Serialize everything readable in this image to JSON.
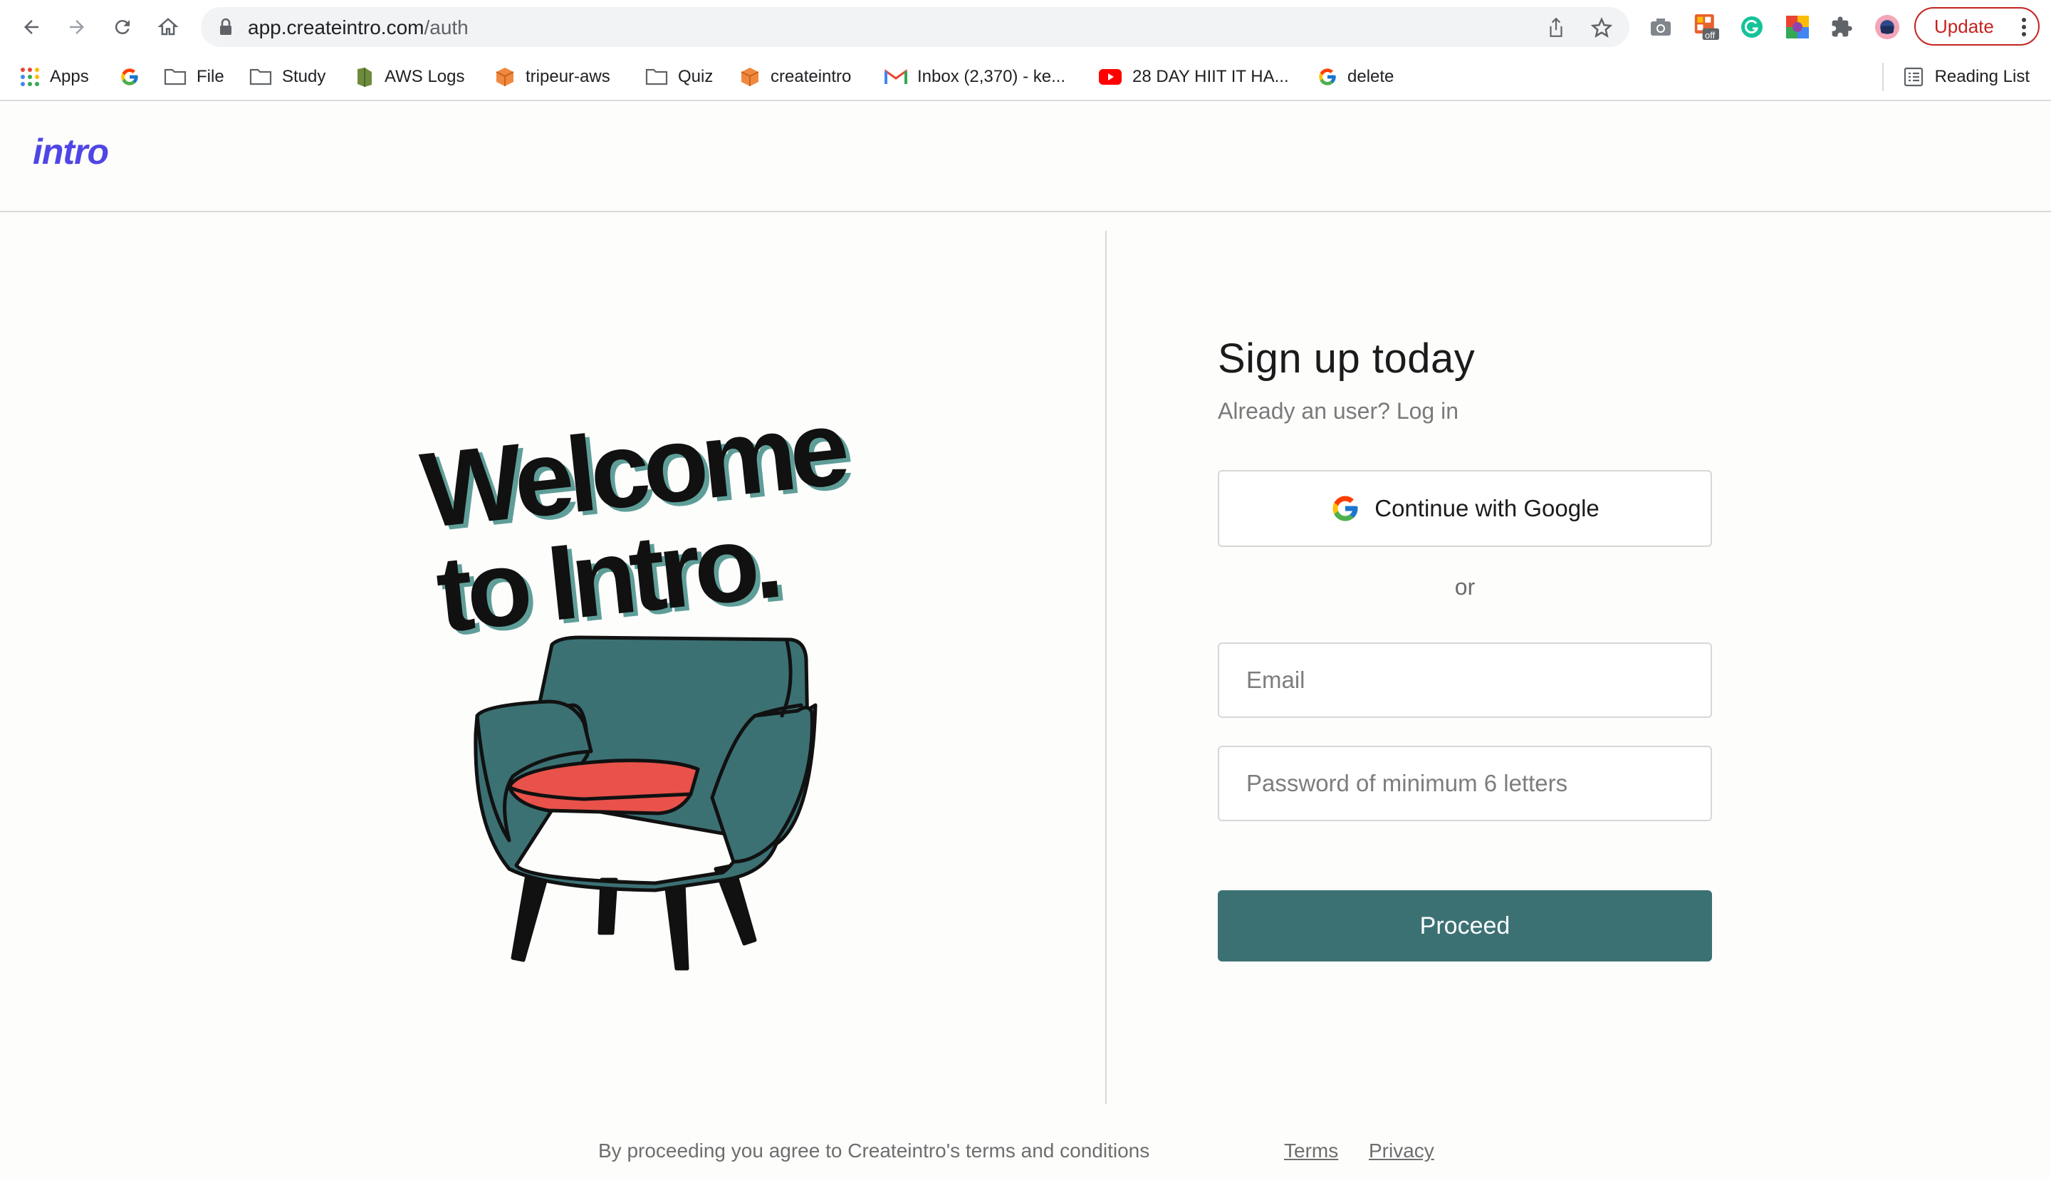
{
  "browser": {
    "url_host": "app.createintro.com",
    "url_path": "/auth",
    "update_label": "Update",
    "extension_badge": "off",
    "bookmarks": [
      {
        "label": "Apps",
        "icon": "apps-grid-icon"
      },
      {
        "label": "",
        "icon": "google-icon"
      },
      {
        "label": "File",
        "icon": "folder-icon"
      },
      {
        "label": "Study",
        "icon": "folder-icon"
      },
      {
        "label": "AWS Logs",
        "icon": "aws-icon"
      },
      {
        "label": "tripeur-aws",
        "icon": "cube-icon"
      },
      {
        "label": "Quiz",
        "icon": "folder-icon"
      },
      {
        "label": "createintro",
        "icon": "cube-icon"
      },
      {
        "label": "Inbox (2,370) - ke...",
        "icon": "gmail-icon"
      },
      {
        "label": "28 DAY HIIT IT HA...",
        "icon": "youtube-icon"
      },
      {
        "label": "delete",
        "icon": "google-icon"
      }
    ],
    "reading_list": "Reading List"
  },
  "header": {
    "logo": "intro"
  },
  "hero": {
    "line1": "Welcome",
    "line2": "to Intro."
  },
  "signup": {
    "title": "Sign up today",
    "subline": "Already an user? Log in",
    "google_label": "Continue with Google",
    "or_label": "or",
    "email_placeholder": "Email",
    "password_placeholder": "Password of minimum 6 letters",
    "proceed_label": "Proceed"
  },
  "footer": {
    "agreement": "By proceeding you agree to Createintro's terms and conditions",
    "terms": "Terms",
    "privacy": "Privacy"
  },
  "colors": {
    "brand": "#5046e5",
    "primary_button": "#3c7174",
    "chair_body": "#3c7174",
    "chair_cushion": "#e8524a",
    "update_red": "#c5221f"
  }
}
